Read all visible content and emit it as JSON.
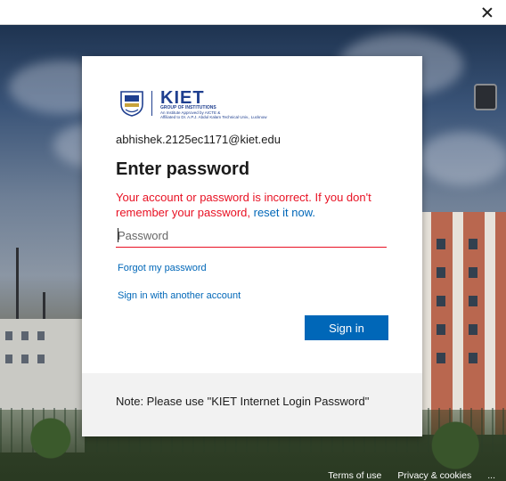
{
  "window": {
    "close_label": "×"
  },
  "logo": {
    "name": "KIET",
    "subtitle_1": "GROUP OF INSTITUTIONS",
    "subtitle_2": "An Institute Approved by AICTE &",
    "subtitle_3": "Affiliated to Dr. A.P.J. Abdul Kalam Technical Univ., Lucknow"
  },
  "dialog": {
    "email": "abhishek.2125ec1171@kiet.edu",
    "heading": "Enter password",
    "error_text": "Your account or password is incorrect. If you don't remember your password, ",
    "error_link": "reset it now.",
    "password_placeholder": "Password",
    "password_value": "",
    "forgot_link": "Forgot my password",
    "another_account_link": "Sign in with another account",
    "signin_button": "Sign in",
    "note": "Note: Please use \"KIET Internet Login Password\""
  },
  "footer": {
    "terms": "Terms of use",
    "privacy": "Privacy & cookies",
    "more": "..."
  },
  "colors": {
    "accent": "#0067b8",
    "error": "#e81123",
    "brand": "#1f3f8f"
  }
}
